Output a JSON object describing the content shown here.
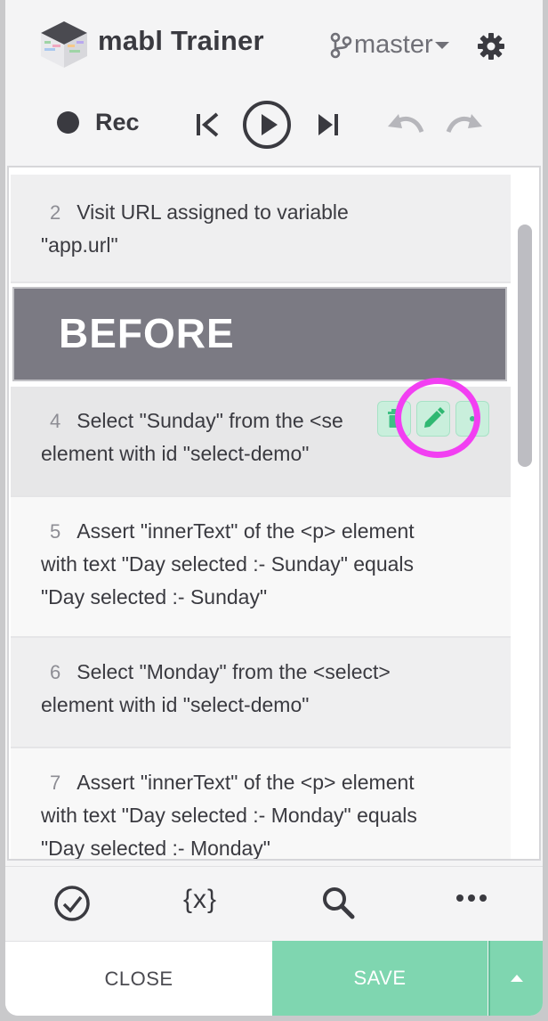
{
  "header": {
    "app_title": "mabl Trainer",
    "branch": "master",
    "rec_label": "Rec"
  },
  "steps": [
    {
      "num": "2",
      "line1": "Visit URL assigned to variable",
      "line2": "\"app.url\""
    },
    {
      "num": "4",
      "line1": "Select \"Sunday\" from the <se",
      "line2": "element with id \"select-demo\""
    },
    {
      "num": "5",
      "line1": "Assert \"innerText\" of the <p> element",
      "line2": "with text \"Day selected :- Sunday\" equals",
      "line3": "\"Day selected :- Sunday\""
    },
    {
      "num": "6",
      "line1": "Select \"Monday\" from the <select>",
      "line2": "element with id \"select-demo\""
    },
    {
      "num": "7",
      "line1": "Assert \"innerText\" of the <p> element",
      "line2": "with text \"Day selected :- Monday\" equals",
      "line3": "\"Day selected :- Monday\""
    }
  ],
  "before_banner": "BEFORE",
  "toolbar": {
    "variables_label": "{x}"
  },
  "footer": {
    "close_label": "CLOSE",
    "save_label": "SAVE"
  },
  "colors": {
    "accent": "#7fd6b0",
    "highlight": "#f23ff2",
    "banner": "#7b7a83",
    "text": "#3a3a40"
  },
  "icons": [
    "logo-icon",
    "branch-icon",
    "chevron-down-icon",
    "gear-icon",
    "record-dot-icon",
    "skip-back-icon",
    "play-icon",
    "skip-forward-icon",
    "undo-icon",
    "redo-icon",
    "trash-icon",
    "pencil-icon",
    "more-icon",
    "check-circle-icon",
    "search-icon",
    "ellipsis-icon",
    "caret-up-icon"
  ]
}
